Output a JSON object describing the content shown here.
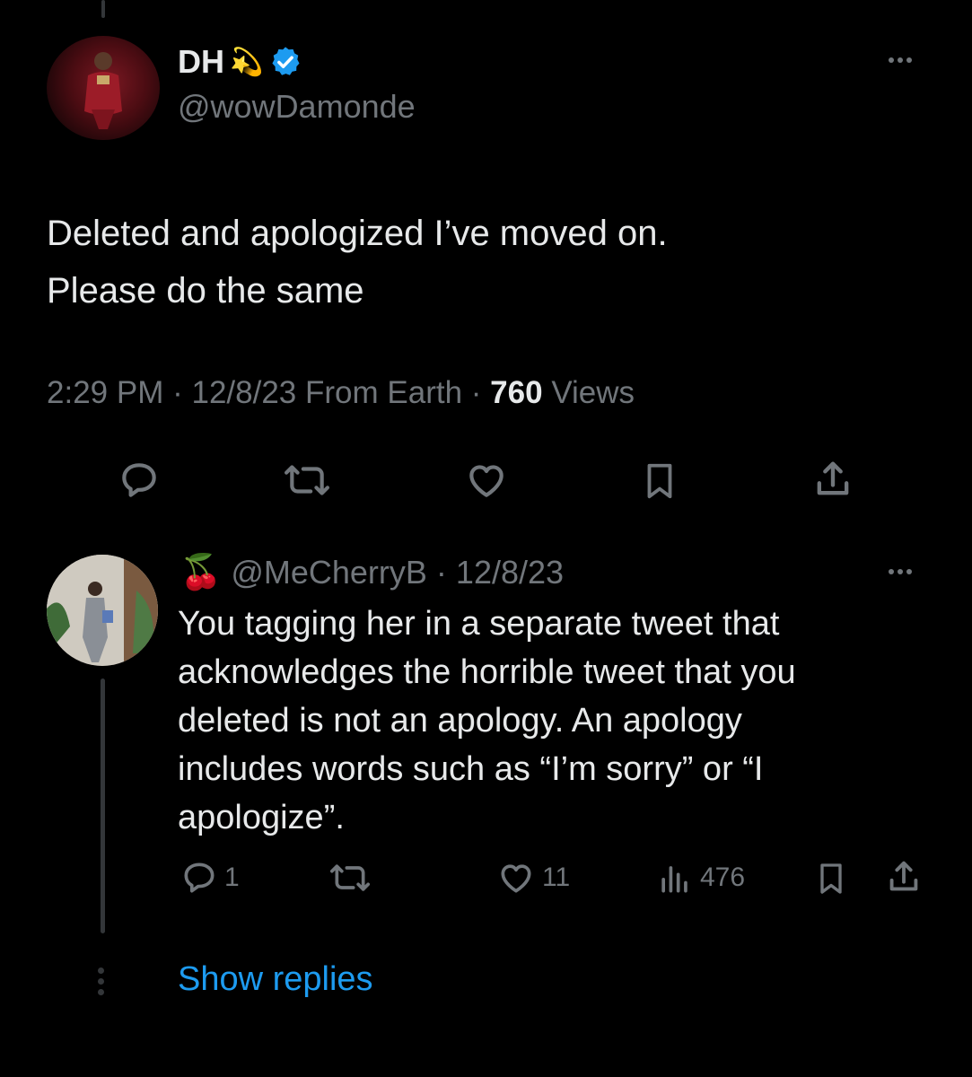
{
  "tweet": {
    "display_name": "DH",
    "name_emoji": "💫",
    "verified": true,
    "handle": "@wowDamonde",
    "text_lines": [
      "Deleted and apologized I’ve moved on.",
      "Please do the same"
    ],
    "time": "2:29 PM",
    "separator": "·",
    "date": "12/8/23",
    "source": "From Earth",
    "views_count": "760",
    "views_label": "Views"
  },
  "reply": {
    "name_emoji": "🍒",
    "handle": "@MeCherryB",
    "separator": "·",
    "date": "12/8/23",
    "text_lines": [
      "You tagging her in a separate tweet that",
      "acknowledges the horrible tweet that you",
      "deleted is not an apology. An apology",
      "includes words such as “I’m sorry” or “I",
      "apologize”."
    ],
    "reply_count": "1",
    "like_count": "11",
    "views_count": "476"
  },
  "show_replies_label": "Show replies",
  "colors": {
    "background": "#000000",
    "text": "#e7e9ea",
    "muted": "#71767b",
    "accent": "#1d9bf0",
    "verified": "#1d9bf0",
    "thread_line": "#333639"
  },
  "icons": [
    "reply-icon",
    "retweet-icon",
    "like-icon",
    "bookmark-icon",
    "share-icon",
    "views-icon",
    "more-icon",
    "verified-badge-icon"
  ]
}
